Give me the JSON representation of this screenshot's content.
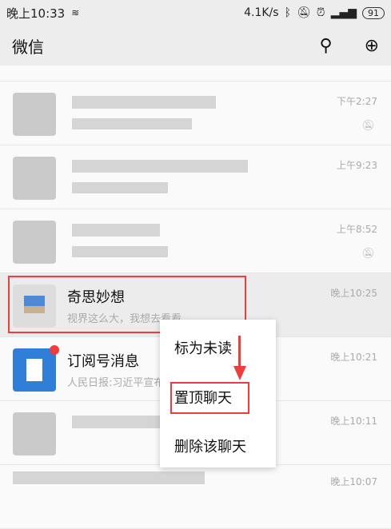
{
  "status": {
    "time": "晚上10:33",
    "speed": "4.1K/s",
    "battery": "91"
  },
  "header": {
    "title": "微信"
  },
  "chats": [
    {
      "time": "下午2:27",
      "muted": true
    },
    {
      "time": "上午9:23",
      "muted": false
    },
    {
      "time": "上午8:52",
      "muted": true
    },
    {
      "name": "奇思妙想",
      "message": "视界这么大，我想去看看",
      "time": "晚上10:25"
    },
    {
      "name": "订阅号消息",
      "message": "人民日报:习近平宣布中非合作五大举措",
      "time": "晚上10:21"
    },
    {
      "time": "晚上10:11"
    },
    {
      "time": "晚上10:07"
    }
  ],
  "menu": {
    "items": [
      "标为未读",
      "置顶聊天",
      "删除该聊天"
    ]
  },
  "colors": {
    "highlight": "#f23b3b",
    "subscription": "#2f7fd8"
  }
}
